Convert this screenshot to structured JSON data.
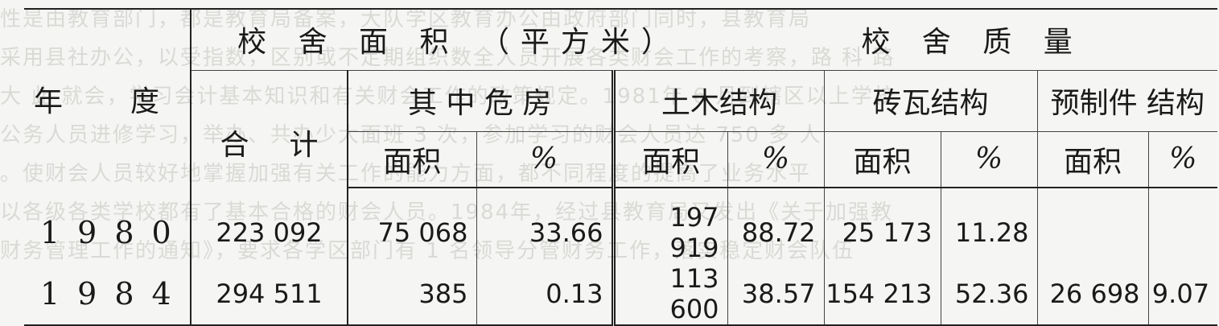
{
  "table": {
    "header": {
      "year_label_1": "年",
      "year_label_2": "度",
      "area_group": "校 舍 面 积 （平方米）",
      "quality_group": "校 舍 质  量",
      "total_label_1": "合",
      "total_label_2": "计",
      "dangerous": "其 中 危 房",
      "wood": "土木结构",
      "brick": "砖瓦结构",
      "prefab": "预制件 结构",
      "sub_area": "面积",
      "sub_pct": "%"
    },
    "rows": [
      {
        "year": "1980",
        "total": "223 092",
        "danger_area": "75 068",
        "danger_pct": "33.66",
        "wood_area": "197 919",
        "wood_pct": "88.72",
        "brick_area": "25 173",
        "brick_pct": "11.28",
        "prefab_area": "",
        "prefab_pct": ""
      },
      {
        "year": "1984",
        "total": "294 511",
        "danger_area": "385",
        "danger_pct": "0.13",
        "wood_area": "113 600",
        "wood_pct": "38.57",
        "brick_area": "154 213",
        "brick_pct": "52.36",
        "prefab_area": "26 698",
        "prefab_pct": "9.07"
      }
    ]
  }
}
